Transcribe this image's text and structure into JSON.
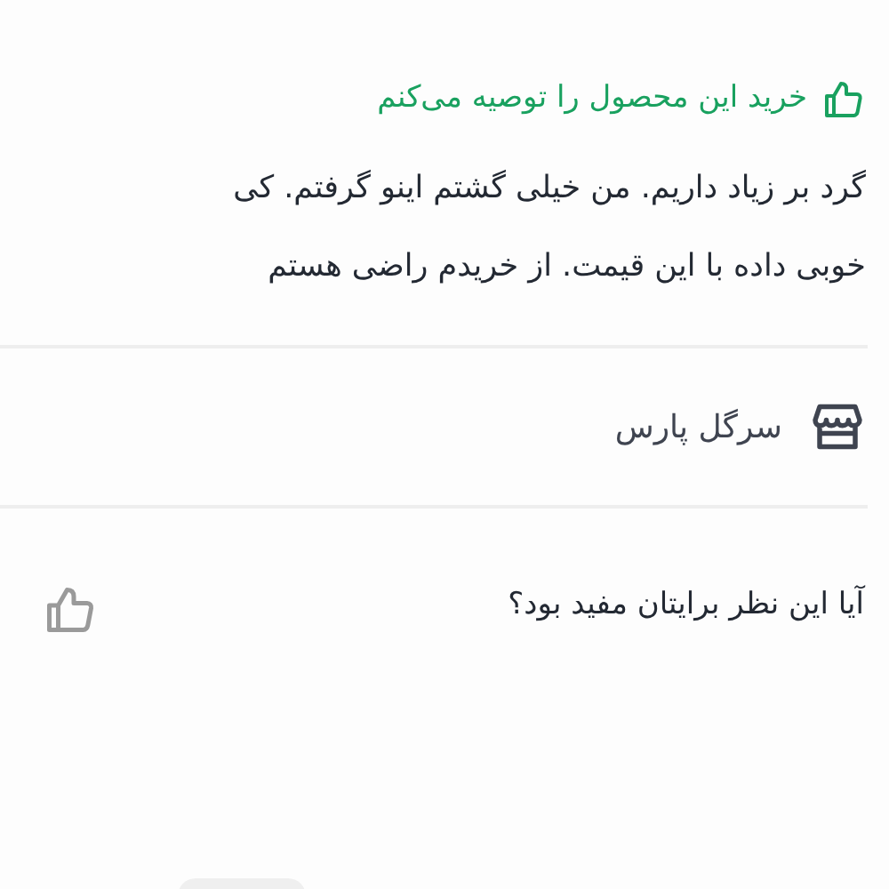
{
  "recommendation": {
    "text": "خرید این محصول را توصیه می‌کنم"
  },
  "review_lines": [
    "گرد بر زیاد داریم. من خیلی گشتم اینو گرفتم. کی",
    "خوبی داده با این قیمت. از خریدم راضی هستم"
  ],
  "seller": {
    "name": "سرگل پارس"
  },
  "helpful": {
    "question": "آیا این نظر برایتان مفید بود؟"
  }
}
